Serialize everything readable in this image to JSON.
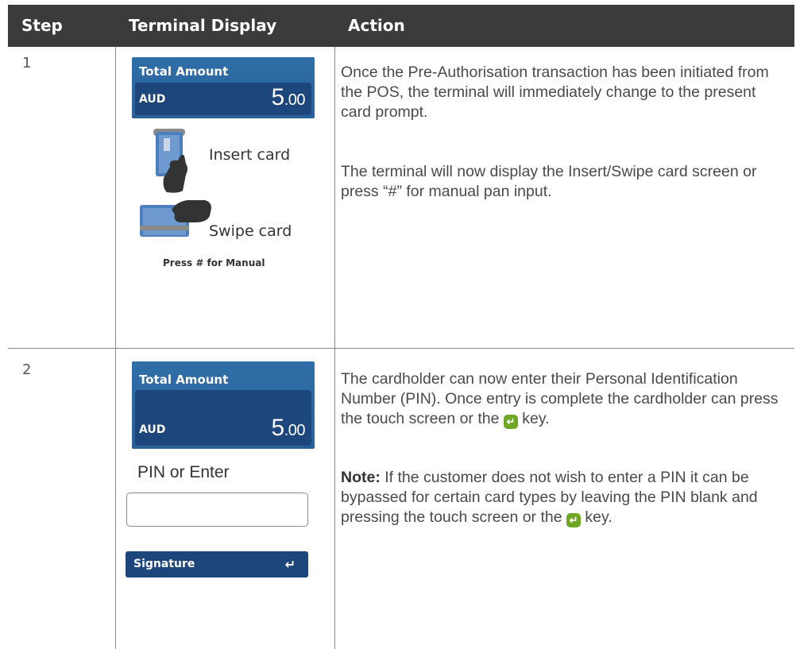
{
  "table": {
    "headers": [
      "Step",
      "Terminal Display",
      "Action"
    ]
  },
  "rows": [
    {
      "step": "1",
      "screen": {
        "title": "Total Amount",
        "currency": "AUD",
        "amount_main": "5",
        "amount_cents": ".00"
      },
      "insert_label": "Insert card",
      "swipe_label": "Swipe card",
      "manual_note": "Press # for Manual",
      "action_paragraphs": [
        "Once the Pre-Authorisation transaction has been initiated from the POS, the terminal will immediately change to the present card prompt.",
        "The terminal will now display the Insert/Swipe card screen or press “#” for manual pan input."
      ]
    },
    {
      "step": "2",
      "screen": {
        "title": "Total Amount",
        "currency": "AUD",
        "amount_main": "5",
        "amount_cents": ".00"
      },
      "pin_label": "PIN or Enter",
      "pin_value": "",
      "signature_label": "Signature",
      "enter_glyph": "↵",
      "action_p1_before": "The cardholder can now enter their Personal Identification Number (PIN). Once entry is complete the cardholder can press the touch screen or the",
      "action_p1_after": " key.",
      "note_label": "Note:",
      "action_p2_before": " If the customer does not wish to enter a PIN it can be bypassed for certain card types by leaving the PIN blank and pressing the touch screen or the",
      "action_p2_after": " key."
    }
  ],
  "colors": {
    "header_bg": "#3b3b3b",
    "screen_blue": "#2f6ea8",
    "screen_dark": "#1d467c",
    "enter_key_green": "#6fa624"
  },
  "icons": [
    "insert-card-icon",
    "swipe-card-icon",
    "enter-key-icon"
  ]
}
